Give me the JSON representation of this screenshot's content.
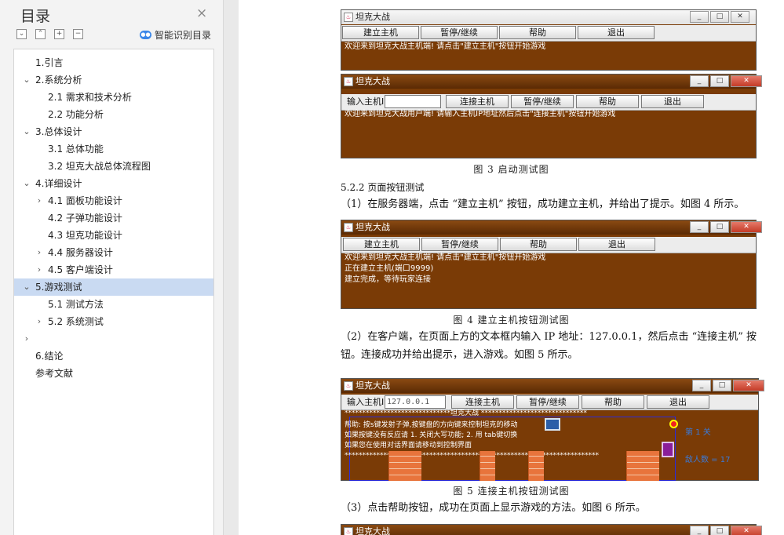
{
  "toc": {
    "title": "目录",
    "close_glyph": "×",
    "buttons": [
      "⌄",
      "⌃",
      "+",
      "−"
    ],
    "smart_label": "智能识别目录",
    "items": [
      {
        "label": "1.引言",
        "level": 1,
        "chevron": ""
      },
      {
        "label": "2.系统分析",
        "level": 1,
        "chevron": "⌄"
      },
      {
        "label": "2.1  需求和技术分析",
        "level": 2,
        "chevron": ""
      },
      {
        "label": "2.2  功能分析",
        "level": 2,
        "chevron": ""
      },
      {
        "label": "3.总体设计",
        "level": 1,
        "chevron": "⌄"
      },
      {
        "label": "3.1  总体功能",
        "level": 2,
        "chevron": ""
      },
      {
        "label": "3.2  坦克大战总体流程图",
        "level": 2,
        "chevron": ""
      },
      {
        "label": "4.详细设计",
        "level": 1,
        "chevron": "⌄"
      },
      {
        "label": "4.1  面板功能设计",
        "level": 2,
        "chevron": "›"
      },
      {
        "label": "4.2 子弹功能设计",
        "level": 2,
        "chevron": ""
      },
      {
        "label": "4.3 坦克功能设计",
        "level": 2,
        "chevron": ""
      },
      {
        "label": "4.4 服务器设计",
        "level": 2,
        "chevron": "›"
      },
      {
        "label": "4.5  客户端设计",
        "level": 2,
        "chevron": "›"
      },
      {
        "label": "5.游戏测试",
        "level": 1,
        "chevron": "⌄",
        "selected": true
      },
      {
        "label": "5.1  测试方法",
        "level": 2,
        "chevron": ""
      },
      {
        "label": "5.2  系统测试",
        "level": 2,
        "chevron": "›"
      },
      {
        "label": "",
        "level": 1,
        "chevron": "›"
      },
      {
        "label": "6.结论",
        "level": 1,
        "chevron": ""
      },
      {
        "label": "参考文献",
        "level": 1,
        "chevron": ""
      }
    ]
  },
  "doc": {
    "fig3": {
      "server_title": "坦克大战",
      "server_buttons": [
        "建立主机",
        "暂停/继续",
        "帮助",
        "退出"
      ],
      "server_msg": "欢迎来到坦克大战主机端! 请点击\"建立主机\"按钮开始游戏",
      "client_title": "坦克大战",
      "client_ip_label": "输入主机IP",
      "client_buttons": [
        "连接主机",
        "暂停/继续",
        "帮助",
        "退出"
      ],
      "client_msg": "欢迎来到坦克大战用户端! 请输入主机IP地址然后点击\"连接主机\"按钮开始游戏",
      "caption": "图 3   启动测试图"
    },
    "sec_522": "5.2.2  页面按钮测试",
    "para1": "（1）在服务器端，点击 “建立主机” 按钮，成功建立主机，并给出了提示。如图 4 所示。",
    "fig4": {
      "title": "坦克大战",
      "buttons": [
        "建立主机",
        "暂停/继续",
        "帮助",
        "退出"
      ],
      "lines": [
        "欢迎来到坦克大战主机端! 请点击\"建立主机\"按钮开始游戏",
        "正在建立主机(端口9999)",
        "建立完成，等待玩家连接"
      ],
      "caption": "图 4   建立主机按钮测试图"
    },
    "para2a": "（2）在客户端，在页面上方的文本框内输入 IP 地址：127.0.0.1，然后点击 “连接主机” 按",
    "para2b": "钮。连接成功并给出提示，进入游戏。如图 5 所示。",
    "fig5": {
      "title": "坦克大战",
      "ip_label": "输入主机IP",
      "ip_value": "127.0.0.1",
      "buttons": [
        "连接主机",
        "暂停/继续",
        "帮助",
        "退出"
      ],
      "banner": "******************************坦克大战 ******************************",
      "help": [
        "帮助: 按s键发射子弹,按键盘的方向键来控制坦克的移动",
        "如果按键没有反应请 1. 关闭大写功能; 2. 用 tab键切换",
        "如果您在使用对话界面请移动到控制界面"
      ],
      "stars": "************************************************************************",
      "level": "第 1 关",
      "enemies": "敌人数 = 17",
      "caption": "图 5   连接主机按钮测试图"
    },
    "para3": "（3）点击帮助按钮，成功在页面上显示游戏的方法。如图 6 所示。",
    "fig6_title": "坦克大战"
  }
}
